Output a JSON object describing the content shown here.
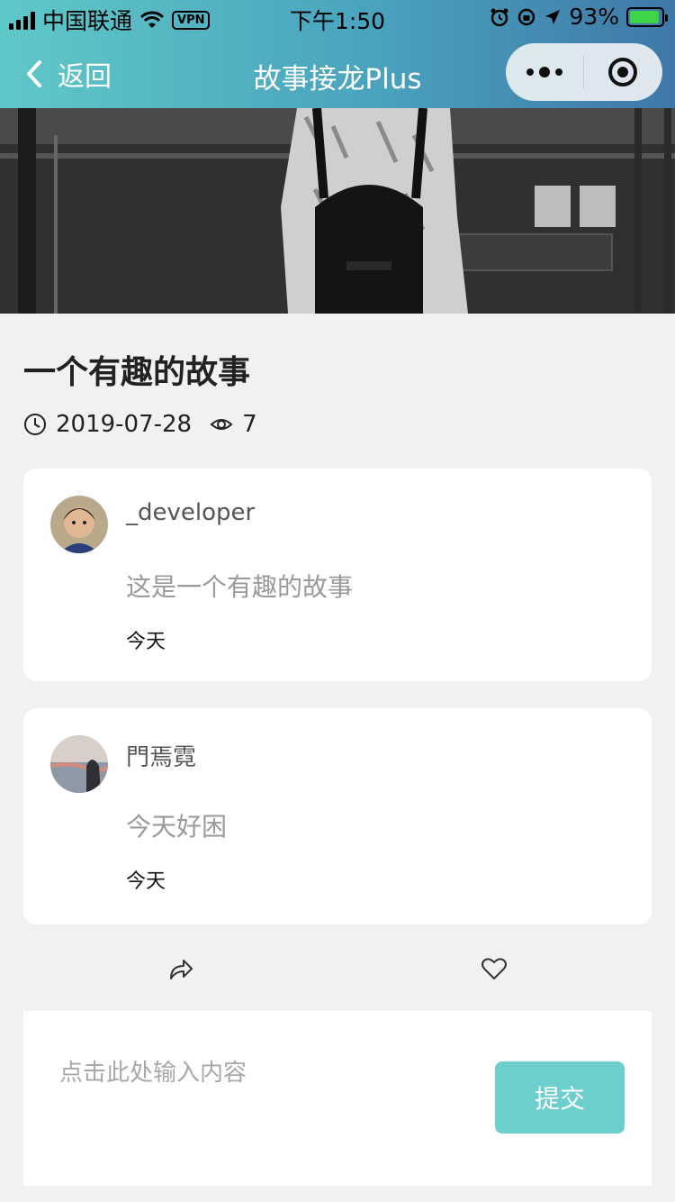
{
  "status_bar": {
    "carrier": "中国联通",
    "vpn": "VPN",
    "time": "下午1:50",
    "battery": "93%",
    "battery_level": 0.93
  },
  "nav": {
    "back_label": "返回",
    "title": "故事接龙Plus"
  },
  "story": {
    "title": "一个有趣的故事",
    "date": "2019-07-28",
    "views": "7"
  },
  "comments": [
    {
      "user": "_developer",
      "content": "这是一个有趣的故事",
      "day": "今天"
    },
    {
      "user": "門焉霓",
      "content": "今天好困",
      "day": "今天"
    }
  ],
  "composer": {
    "placeholder": "点击此处输入内容",
    "submit_label": "提交"
  },
  "colors": {
    "accent": "#6ccfcb",
    "nav_gradient_start": "#5fc8c8",
    "nav_gradient_end": "#3f78a8"
  }
}
